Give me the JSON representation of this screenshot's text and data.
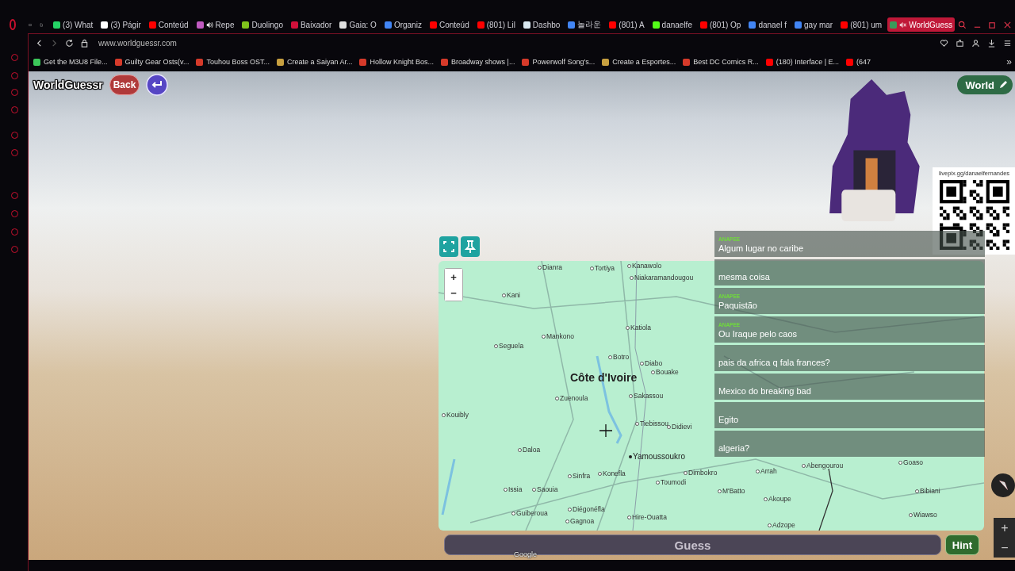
{
  "browser": {
    "tabs": [
      {
        "label": "(3) What",
        "color": "#25d366",
        "audio": false,
        "selected": false
      },
      {
        "label": "(3) Págir",
        "color": "#ffffff",
        "audio": false,
        "selected": false
      },
      {
        "label": "Conteúd",
        "color": "#ff0000",
        "audio": false,
        "selected": false
      },
      {
        "label": "Repe",
        "color": "#c05ac0",
        "audio": true,
        "muted": false,
        "selected": false
      },
      {
        "label": "Duolingo",
        "color": "#7fc31c",
        "audio": false,
        "selected": false
      },
      {
        "label": "Baixador",
        "color": "#d0103a",
        "audio": false,
        "selected": false
      },
      {
        "label": "Gaia: O",
        "color": "#e0e0e0",
        "audio": false,
        "selected": false
      },
      {
        "label": "Organiz",
        "color": "#4285f4",
        "audio": false,
        "selected": false
      },
      {
        "label": "Conteúd",
        "color": "#ff0000",
        "audio": false,
        "selected": false
      },
      {
        "label": "(801) Lil",
        "color": "#ff0000",
        "audio": false,
        "selected": false
      },
      {
        "label": "Dashbo",
        "color": "#d9e8f0",
        "audio": false,
        "selected": false
      },
      {
        "label": "놀라운",
        "color": "#4285f4",
        "audio": false,
        "selected": false
      },
      {
        "label": "(801) A",
        "color": "#ff0000",
        "audio": false,
        "selected": false
      },
      {
        "label": "danaelfe",
        "color": "#53fc18",
        "audio": false,
        "selected": false
      },
      {
        "label": "(801) Op",
        "color": "#ff0000",
        "audio": false,
        "selected": false
      },
      {
        "label": "danael f",
        "color": "#4285f4",
        "audio": false,
        "selected": false
      },
      {
        "label": "gay mar",
        "color": "#4285f4",
        "audio": false,
        "selected": false
      },
      {
        "label": "(801) um",
        "color": "#ff0000",
        "audio": false,
        "selected": false
      },
      {
        "label": "WorldGuess",
        "color": "#3a9a5a",
        "audio": true,
        "muted": true,
        "selected": true
      }
    ],
    "address": "www.worldguessr.com",
    "bookmarks": [
      {
        "label": "Get the M3U8 File...",
        "color": "#3cc85a"
      },
      {
        "label": "Guilty Gear Osts(v...",
        "color": "#d63a2a"
      },
      {
        "label": "Touhou Boss OST...",
        "color": "#d63a2a"
      },
      {
        "label": "Create a Saiyan Ar...",
        "color": "#c8a040"
      },
      {
        "label": "Hollow Knight Bos...",
        "color": "#d63a2a"
      },
      {
        "label": "Broadway shows |...",
        "color": "#d63a2a"
      },
      {
        "label": "Powerwolf Song's...",
        "color": "#d63a2a"
      },
      {
        "label": "Create a Esportes...",
        "color": "#c8a040"
      },
      {
        "label": "Best DC Comics R...",
        "color": "#d63a2a"
      },
      {
        "label": "(180) Interface | E...",
        "color": "#ff0000"
      },
      {
        "label": "(647",
        "color": "#ff0000"
      }
    ],
    "more_bookmarks": "»"
  },
  "game": {
    "logo": "WorldGuessr",
    "back_button": "Back",
    "mode_button": "World",
    "donation_caption": "livepix.gg/danaelfernandes",
    "chat": [
      {
        "user": "ANAPEE",
        "message": "Algum lugar no caribe"
      },
      {
        "message": "mesma coisa"
      },
      {
        "user": "ANAPEE",
        "message": "Paquistão"
      },
      {
        "user": "ANAPEE",
        "message": "Ou Iraque pelo caos"
      },
      {
        "message": "pais da africa q fala frances?"
      },
      {
        "message": "Mexico do breaking bad"
      },
      {
        "message": "Egito"
      },
      {
        "message": "algeria?"
      }
    ],
    "map": {
      "zoom_in": "+",
      "zoom_out": "−",
      "labels": [
        {
          "text": "Dianra",
          "kind": "city"
        },
        {
          "text": "Tortiya",
          "kind": "city"
        },
        {
          "text": "Kanawolo",
          "kind": "city"
        },
        {
          "text": "Niakaramandougou",
          "kind": "city"
        },
        {
          "text": "Kani",
          "kind": "city"
        },
        {
          "text": "Mankono",
          "kind": "city"
        },
        {
          "text": "Seguela",
          "kind": "city"
        },
        {
          "text": "Katiola",
          "kind": "city"
        },
        {
          "text": "Botro",
          "kind": "city"
        },
        {
          "text": "Diabo",
          "kind": "city"
        },
        {
          "text": "Bouake",
          "kind": "city"
        },
        {
          "text": "Côte d'Ivoire",
          "kind": "country"
        },
        {
          "text": "Zuenoula",
          "kind": "city"
        },
        {
          "text": "Sakassou",
          "kind": "city"
        },
        {
          "text": "Tiebissou",
          "kind": "city"
        },
        {
          "text": "Didievi",
          "kind": "city"
        },
        {
          "text": "Kouibly",
          "kind": "city"
        },
        {
          "text": "Daloa",
          "kind": "city"
        },
        {
          "text": "Yamoussoukro",
          "kind": "capital"
        },
        {
          "text": "Konefla",
          "kind": "city"
        },
        {
          "text": "Sinfra",
          "kind": "city"
        },
        {
          "text": "Dimbokro",
          "kind": "city"
        },
        {
          "text": "Toumodi",
          "kind": "city"
        },
        {
          "text": "Issia",
          "kind": "city"
        },
        {
          "text": "Saouia",
          "kind": "city"
        },
        {
          "text": "Guiberoua",
          "kind": "city"
        },
        {
          "text": "Diégonéfla",
          "kind": "city"
        },
        {
          "text": "Hire-Ouatta",
          "kind": "city"
        },
        {
          "text": "Gagnoa",
          "kind": "city"
        },
        {
          "text": "M'Batto",
          "kind": "city"
        },
        {
          "text": "Arrah",
          "kind": "city"
        },
        {
          "text": "Abengourou",
          "kind": "city"
        },
        {
          "text": "Goaso",
          "kind": "city"
        },
        {
          "text": "Akoupe",
          "kind": "city"
        },
        {
          "text": "Bibiani",
          "kind": "city"
        },
        {
          "text": "Wiawso",
          "kind": "city"
        },
        {
          "text": "Adzope",
          "kind": "city"
        }
      ]
    },
    "guess_button": "Guess",
    "hint_button": "Hint",
    "view_zoom_in": "+",
    "view_zoom_out": "−",
    "attribution": "Google"
  }
}
